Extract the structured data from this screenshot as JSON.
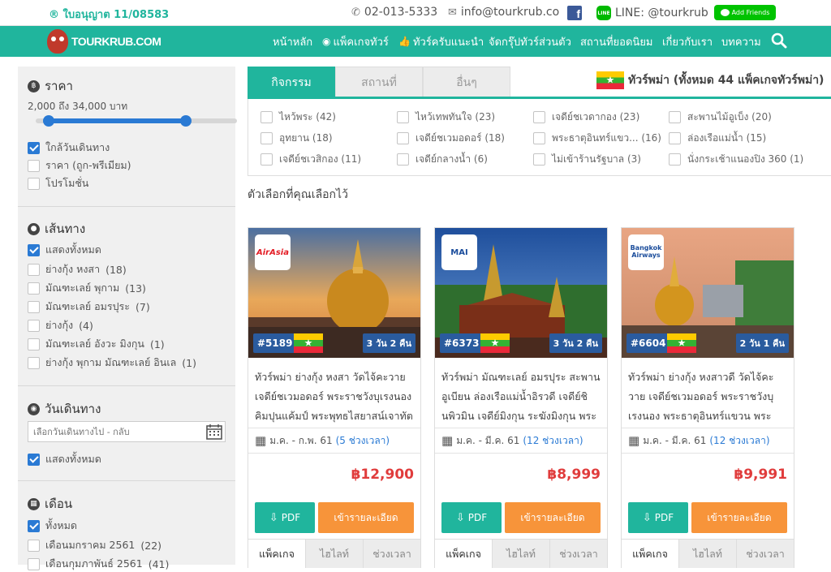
{
  "topbar": {
    "license": "® ใบอนุญาต 11/08583",
    "phone": "02-013-5333",
    "email": "info@tourkrub.co",
    "line": "LINE: @tourkrub",
    "add_friends": "Add Friends"
  },
  "brand": {
    "logo_text": "TOURKRUB.COM"
  },
  "nav": {
    "items": [
      "หน้าหลัก",
      "แพ็คเกจทัวร์",
      "ทัวร์ครับแนะนำ",
      "จัดกรุ๊ปทัวร์ส่วนตัว",
      "สถานที่ยอดนิยม",
      "เกี่ยวกับเรา",
      "บทความ"
    ]
  },
  "sidebar": {
    "price": {
      "title": "ราคา",
      "range": "2,000 ถึง 34,000 บาท",
      "min_frac": 0.04,
      "max_frac": 0.76,
      "options": [
        {
          "label": "ใกล้วันเดินทาง",
          "checked": true
        },
        {
          "label": "ราคา (ถูก-พรีเมียม)",
          "checked": false
        },
        {
          "label": "โปรโมชั่น",
          "checked": false
        }
      ]
    },
    "route": {
      "title": "เส้นทาง",
      "options": [
        {
          "label": "แสดงทั้งหมด",
          "checked": true
        },
        {
          "label": "ย่างกุ้ง หงสา",
          "count": "(18)",
          "checked": false
        },
        {
          "label": "มัณฑะเลย์ พุกาม",
          "count": "(13)",
          "checked": false
        },
        {
          "label": "มัณฑะเลย์ อมรปุระ",
          "count": "(7)",
          "checked": false
        },
        {
          "label": "ย่างกุ้ง",
          "count": "(4)",
          "checked": false
        },
        {
          "label": "มัณฑะเลย์ อังวะ มิงกุน",
          "count": "(1)",
          "checked": false
        },
        {
          "label": "ย่างกุ้ง พุกาม มัณฑะเลย์ อินเล",
          "count": "(1)",
          "checked": false
        }
      ]
    },
    "travel_date": {
      "title": "วันเดินทาง",
      "placeholder": "เลือกวันเดินทางไป - กลับ",
      "show_all": "แสดงทั้งหมด"
    },
    "month": {
      "title": "เดือน",
      "options": [
        {
          "label": "ทั้งหมด",
          "checked": true
        },
        {
          "label": "เดือนมกราคม 2561",
          "count": "(22)",
          "checked": false
        },
        {
          "label": "เดือนกุมภาพันธ์ 2561",
          "count": "(41)",
          "checked": false
        }
      ]
    }
  },
  "tabs": [
    "กิจกรรม",
    "สถานที่",
    "อื่นๆ"
  ],
  "heading": "ทัวร์พม่า (ทั้งหมด 44 แพ็คเกจทัวร์พม่า)",
  "filters": [
    "ไหว้พระ (42)",
    "ไหว้เทพทันใจ (23)",
    "เจดีย์ชเวดากอง (23)",
    "สะพานไม้อูเบ็ง (20)",
    "อุทยาน (18)",
    "เจดีย์ชเวมอดอร์ (18)",
    "พระธาตุอินทร์แขว... (16)",
    "ล่องเรือแม่น้ำ (15)",
    "เจดีย์ชเวสิกอง (11)",
    "เจดีย์กลางน้ำ (6)",
    "ไม่เข้าร้านรัฐบาล (3)",
    "นั่งกระเช้าแนองปิง 360 (1)"
  ],
  "chosen_label": "ตัวเลือกที่คุณเลือกไว้",
  "cards": [
    {
      "airline": "AirAsia",
      "code": "#5189",
      "duration": "3 วัน 2 คืน",
      "title": "ทัวร์พม่า ย่างกุ้ง หงสา วัดไจ้คะวาย เจดีย์ชเวมอดอร์ พระราชวังบุเรงนอง คิมปุนแค้มป์ พระพุทธไสยาสน์เจาทัตยี . . .",
      "date": "ม.ค. - ก.พ. 61",
      "slots": "(5 ช่วงเวลา)",
      "price": "฿12,900"
    },
    {
      "airline": "MAI",
      "code": "#6373",
      "duration": "3 วัน 2 คืน",
      "title": "ทัวร์พม่า มัณฑะเลย์ อมรปุระ สะพานอูเบียน ล่องเรือแม่น้ำอิรวดี เจดีย์ชินพิวมิน เจดีย์มิงกุน ระฆังมิงกุน พระราชวั . . .",
      "date": "ม.ค. - มี.ค. 61",
      "slots": "(12 ช่วงเวลา)",
      "price": "฿8,999"
    },
    {
      "airline": "Bangkok Airways",
      "code": "#6604",
      "duration": "2 วัน 1 คืน",
      "title": "ทัวร์พม่า ย่างกุ้ง หงสาวดี วัดไจ้คะวาย เจดีย์ชเวมอดอร์ พระราชวังบุเรงนอง พระธาตุอินทร์แขวน พระนอนชเวตา . . .",
      "date": "ม.ค. - มี.ค. 61",
      "slots": "(12 ช่วงเวลา)",
      "price": "฿9,991"
    }
  ],
  "card_buttons": {
    "pdf": "PDF",
    "detail": "เข้ารายละเอียด"
  },
  "card_tabs": [
    "แพ็คเกจ",
    "ไฮไลท์",
    "ช่วงเวลา"
  ],
  "colors": {
    "brand_teal": "#20b59d",
    "primary_blue": "#2a7ad4",
    "price_red": "#e03c3c",
    "button_orange": "#f7943a",
    "badge_blue": "#2a5b9e"
  }
}
